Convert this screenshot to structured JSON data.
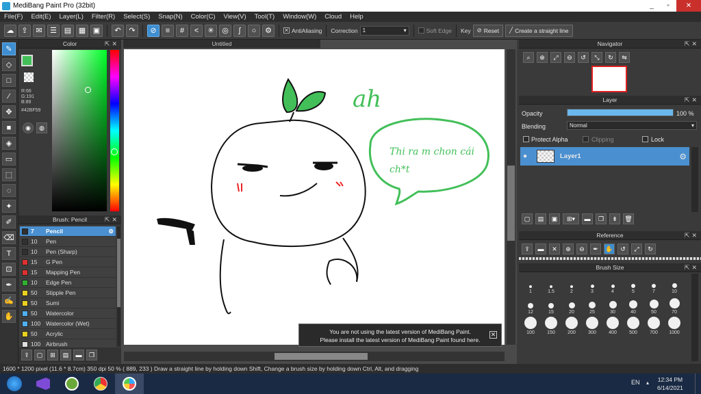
{
  "window": {
    "title": "MediBang Paint Pro (32bit)"
  },
  "menu": [
    "File(F)",
    "Edit(E)",
    "Layer(L)",
    "Filter(R)",
    "Select(S)",
    "Snap(N)",
    "Color(C)",
    "View(V)",
    "Tool(T)",
    "Window(W)",
    "Cloud",
    "Help"
  ],
  "toolbar": {
    "antialiasing_label": "AntiAliasing",
    "correction_label": "Correction",
    "correction_value": "1",
    "soft_edge_label": "Soft Edge",
    "key_label": "Key",
    "reset_label": "Reset",
    "straight_line_label": "Create a straight line"
  },
  "color_panel": {
    "title": "Color",
    "r": "R:66",
    "g": "G:191",
    "b": "B:89",
    "hex": "#42BF59",
    "primary_color": "#42BF59"
  },
  "brush_panel": {
    "title": "Brush: Pencil",
    "items": [
      {
        "size": "7",
        "name": "Pencil",
        "color": "#303030",
        "selected": true
      },
      {
        "size": "10",
        "name": "Pen",
        "color": "#303030"
      },
      {
        "size": "10",
        "name": "Pen (Sharp)",
        "color": "#303030"
      },
      {
        "size": "15",
        "name": "G Pen",
        "color": "#e03030"
      },
      {
        "size": "15",
        "name": "Mapping Pen",
        "color": "#e03030"
      },
      {
        "size": "10",
        "name": "Edge Pen",
        "color": "#30b030"
      },
      {
        "size": "50",
        "name": "Stipple Pen",
        "color": "#e8d020"
      },
      {
        "size": "50",
        "name": "Sumi",
        "color": "#e8d020"
      },
      {
        "size": "50",
        "name": "Watercolor",
        "color": "#50b0f0"
      },
      {
        "size": "100",
        "name": "Watercolor (Wet)",
        "color": "#50b0f0"
      },
      {
        "size": "50",
        "name": "Acrylic",
        "color": "#e8d020"
      },
      {
        "size": "100",
        "name": "Airbrush",
        "color": "#e0e0e0"
      }
    ]
  },
  "canvas": {
    "tab_title": "Untitled",
    "text_ah": "ah",
    "bubble_line1": "Thi ra m chon cái",
    "bubble_line2": "ch*t"
  },
  "notice": {
    "line1": "You are not using the latest version of MediBang Paint.",
    "line2": "Please install the latest version of MediBang Paint found here."
  },
  "navigator": {
    "title": "Navigator"
  },
  "layer_panel": {
    "title": "Layer",
    "opacity_label": "Opacity",
    "opacity_value": "100 %",
    "opacity_fraction": 1.0,
    "blending_label": "Blending",
    "blending_value": "Normal",
    "protect_alpha_label": "Protect Alpha",
    "clipping_label": "Clipping",
    "lock_label": "Lock",
    "layer_name": "Layer1"
  },
  "reference": {
    "title": "Reference"
  },
  "brush_size": {
    "title": "Brush Size",
    "sizes": [
      "1",
      "1.5",
      "2",
      "3",
      "4",
      "5",
      "7",
      "10",
      "12",
      "15",
      "20",
      "25",
      "30",
      "40",
      "50",
      "70",
      "100",
      "150",
      "200",
      "300",
      "400",
      "500",
      "700",
      "1000"
    ]
  },
  "status": {
    "text": "1600 * 1200 pixel   (11.6 * 8.7cm)   350 dpi   50 %   ( 889, 233 )   Draw a straight line by holding down Shift, Change a brush size by holding down Ctrl, Alt, and dragging"
  },
  "taskbar": {
    "lang": "EN",
    "time": "12:34 PM",
    "date": "6/14/2021"
  }
}
